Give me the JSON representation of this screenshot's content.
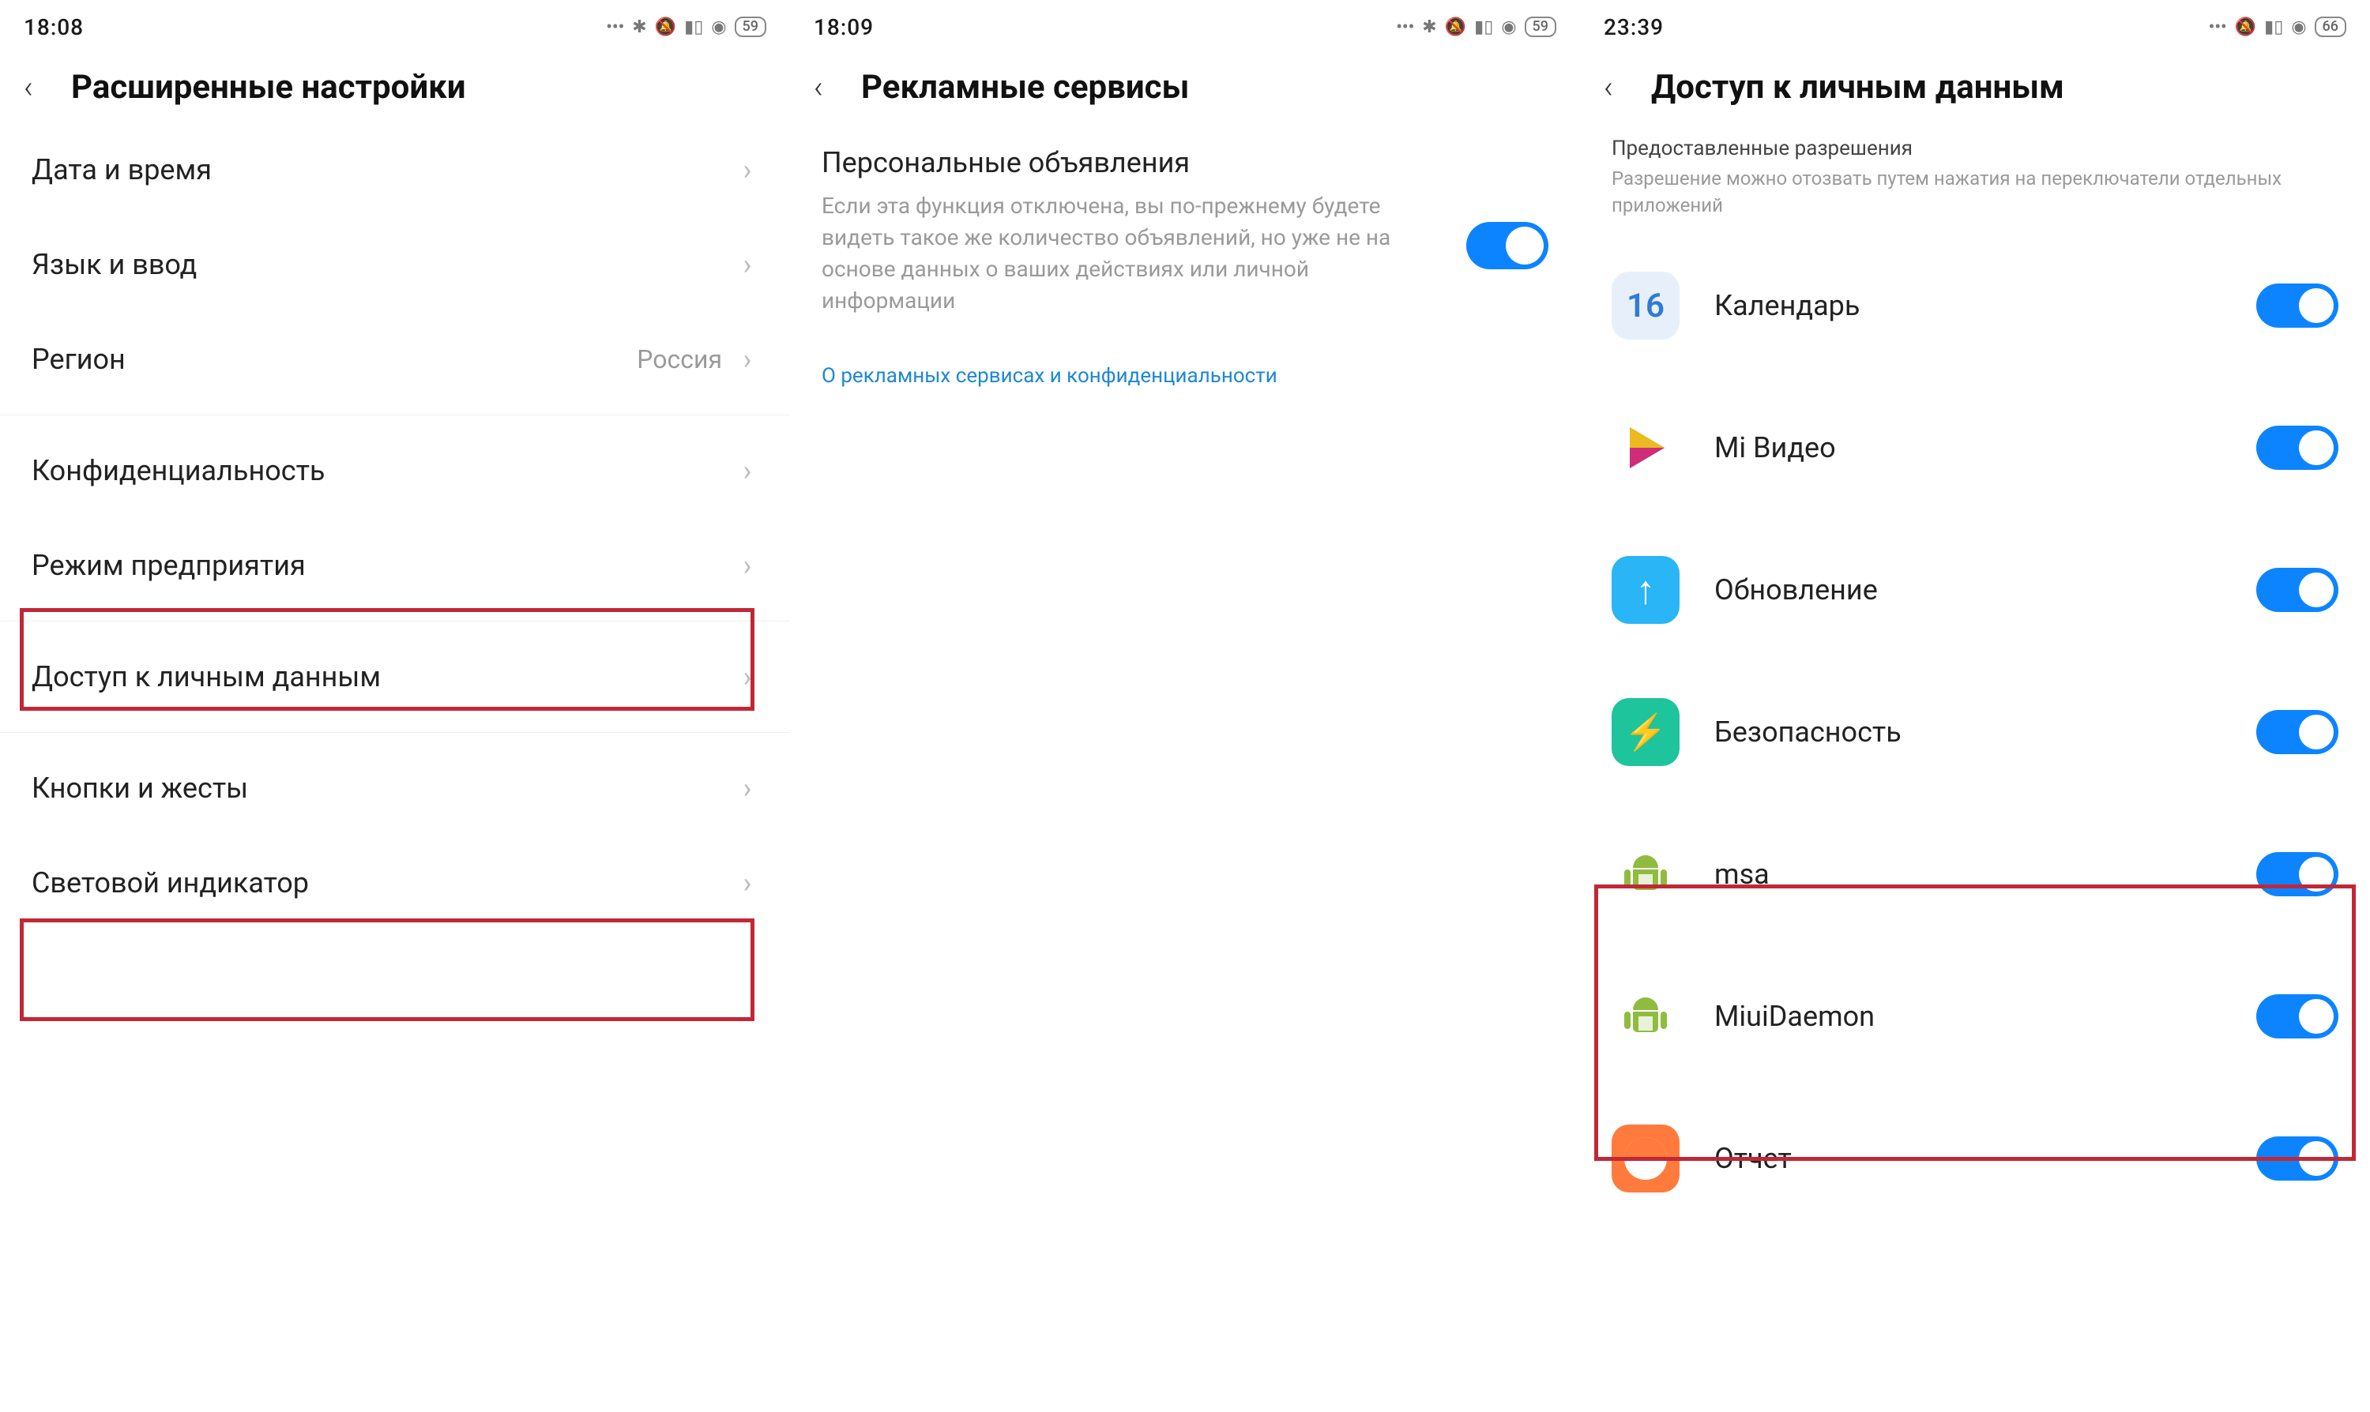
{
  "screen1": {
    "time": "18:08",
    "battery": "59",
    "title": "Расширенные настройки",
    "rows": {
      "datetime": "Дата и время",
      "lang": "Язык и ввод",
      "region_label": "Регион",
      "region_value": "Россия",
      "privacy": "Конфиденциальность",
      "enterprise": "Режим предприятия",
      "personal_data": "Доступ к личным данным",
      "buttons_gestures": "Кнопки и жесты",
      "led": "Световой индикатор"
    }
  },
  "screen2": {
    "time": "18:09",
    "battery": "59",
    "title": "Рекламные сервисы",
    "row_title": "Персональные объявления",
    "row_desc": "Если эта функция отключена, вы по-прежнему будете видеть такое же количество объявлений, но уже не на основе данных о ваших действиях или личной информации",
    "link": "О рекламных сервисах и конфиденциальности"
  },
  "screen3": {
    "time": "23:39",
    "battery": "66",
    "title": "Доступ к личным данным",
    "sub_title": "Предоставленные разрешения",
    "sub_desc": "Разрешение можно отозвать путем нажатия на переключатели отдельных приложений",
    "apps": {
      "calendar": "Календарь",
      "calendar_day": "16",
      "mivideo": "Mi Видео",
      "update": "Обновление",
      "security": "Безопасность",
      "msa": "msa",
      "miuidaemon": "MiuiDaemon",
      "report": "Отчет"
    }
  }
}
